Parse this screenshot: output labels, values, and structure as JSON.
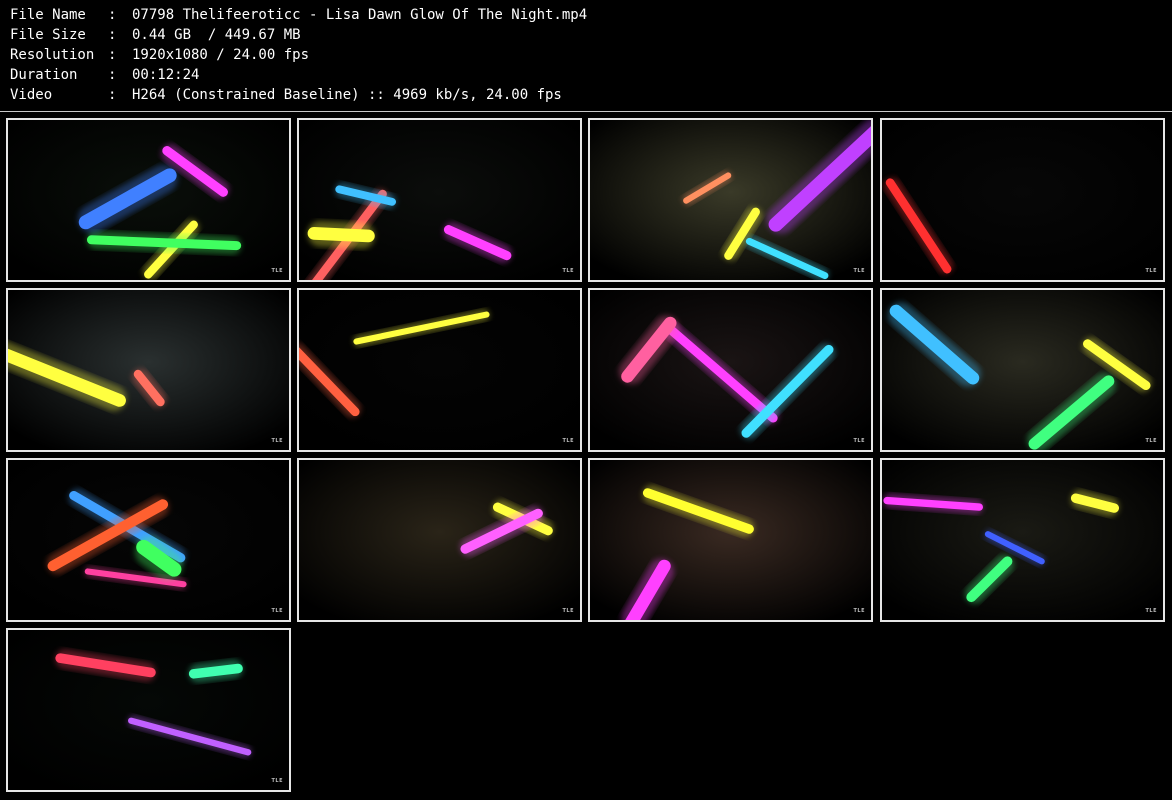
{
  "info": {
    "file_name": {
      "label": "File Name",
      "sep": ":",
      "value": "07798 Thelifeeroticc - Lisa Dawn Glow Of The Night.mp4"
    },
    "file_size": {
      "label": "File Size",
      "sep": ":",
      "value": "0.44 GB  / 449.67 MB"
    },
    "resolution": {
      "label": "Resolution",
      "sep": ":",
      "value": "1920x1080 / 24.00 fps"
    },
    "duration": {
      "label": "Duration",
      "sep": ":",
      "value": "00:12:24"
    },
    "video": {
      "label": "Video",
      "sep": ":",
      "value": "H264 (Constrained Baseline) :: 4969 kb/s, 24.00 fps"
    }
  },
  "watermark": "TLE",
  "thumbnails": [
    {
      "id": 1,
      "bg": "#0a0f0a",
      "glows": [
        "#ffff40",
        "#ff40ff",
        "#40ff60",
        "#4080ff"
      ]
    },
    {
      "id": 2,
      "bg": "#0b0d0b",
      "glows": [
        "#ff6060",
        "#ffff40",
        "#40c0ff",
        "#ff40ff"
      ]
    },
    {
      "id": 3,
      "bg": "#3a3a28",
      "glows": [
        "#ffff40",
        "#ff9060",
        "#40e0ff",
        "#c040ff"
      ]
    },
    {
      "id": 4,
      "bg": "#070707",
      "glows": [
        "#ff3030"
      ]
    },
    {
      "id": 5,
      "bg": "#2a3030",
      "glows": [
        "#ff7060",
        "#ffff40"
      ]
    },
    {
      "id": 6,
      "bg": "#040404",
      "glows": [
        "#ff6040",
        "#ffff40"
      ]
    },
    {
      "id": 7,
      "bg": "#1a1414",
      "glows": [
        "#ff40ff",
        "#40e0ff",
        "#ff60a0"
      ]
    },
    {
      "id": 8,
      "bg": "#2a2a20",
      "glows": [
        "#ffff40",
        "#40c0ff",
        "#40ff80"
      ]
    },
    {
      "id": 9,
      "bg": "#060606",
      "glows": [
        "#40a0ff",
        "#ff40a0",
        "#ff6030",
        "#40ff60"
      ]
    },
    {
      "id": 10,
      "bg": "#2a2418",
      "glows": [
        "#ffff40",
        "#ff60ff"
      ]
    },
    {
      "id": 11,
      "bg": "#3a2a22",
      "glows": [
        "#ffff30",
        "#ff40ff"
      ]
    },
    {
      "id": 12,
      "bg": "#1a1a14",
      "glows": [
        "#ffff40",
        "#4060ff",
        "#ff40ff",
        "#40ff80"
      ]
    },
    {
      "id": 13,
      "bg": "#050806",
      "glows": [
        "#ff4060",
        "#40ffb0",
        "#c060ff"
      ]
    }
  ]
}
